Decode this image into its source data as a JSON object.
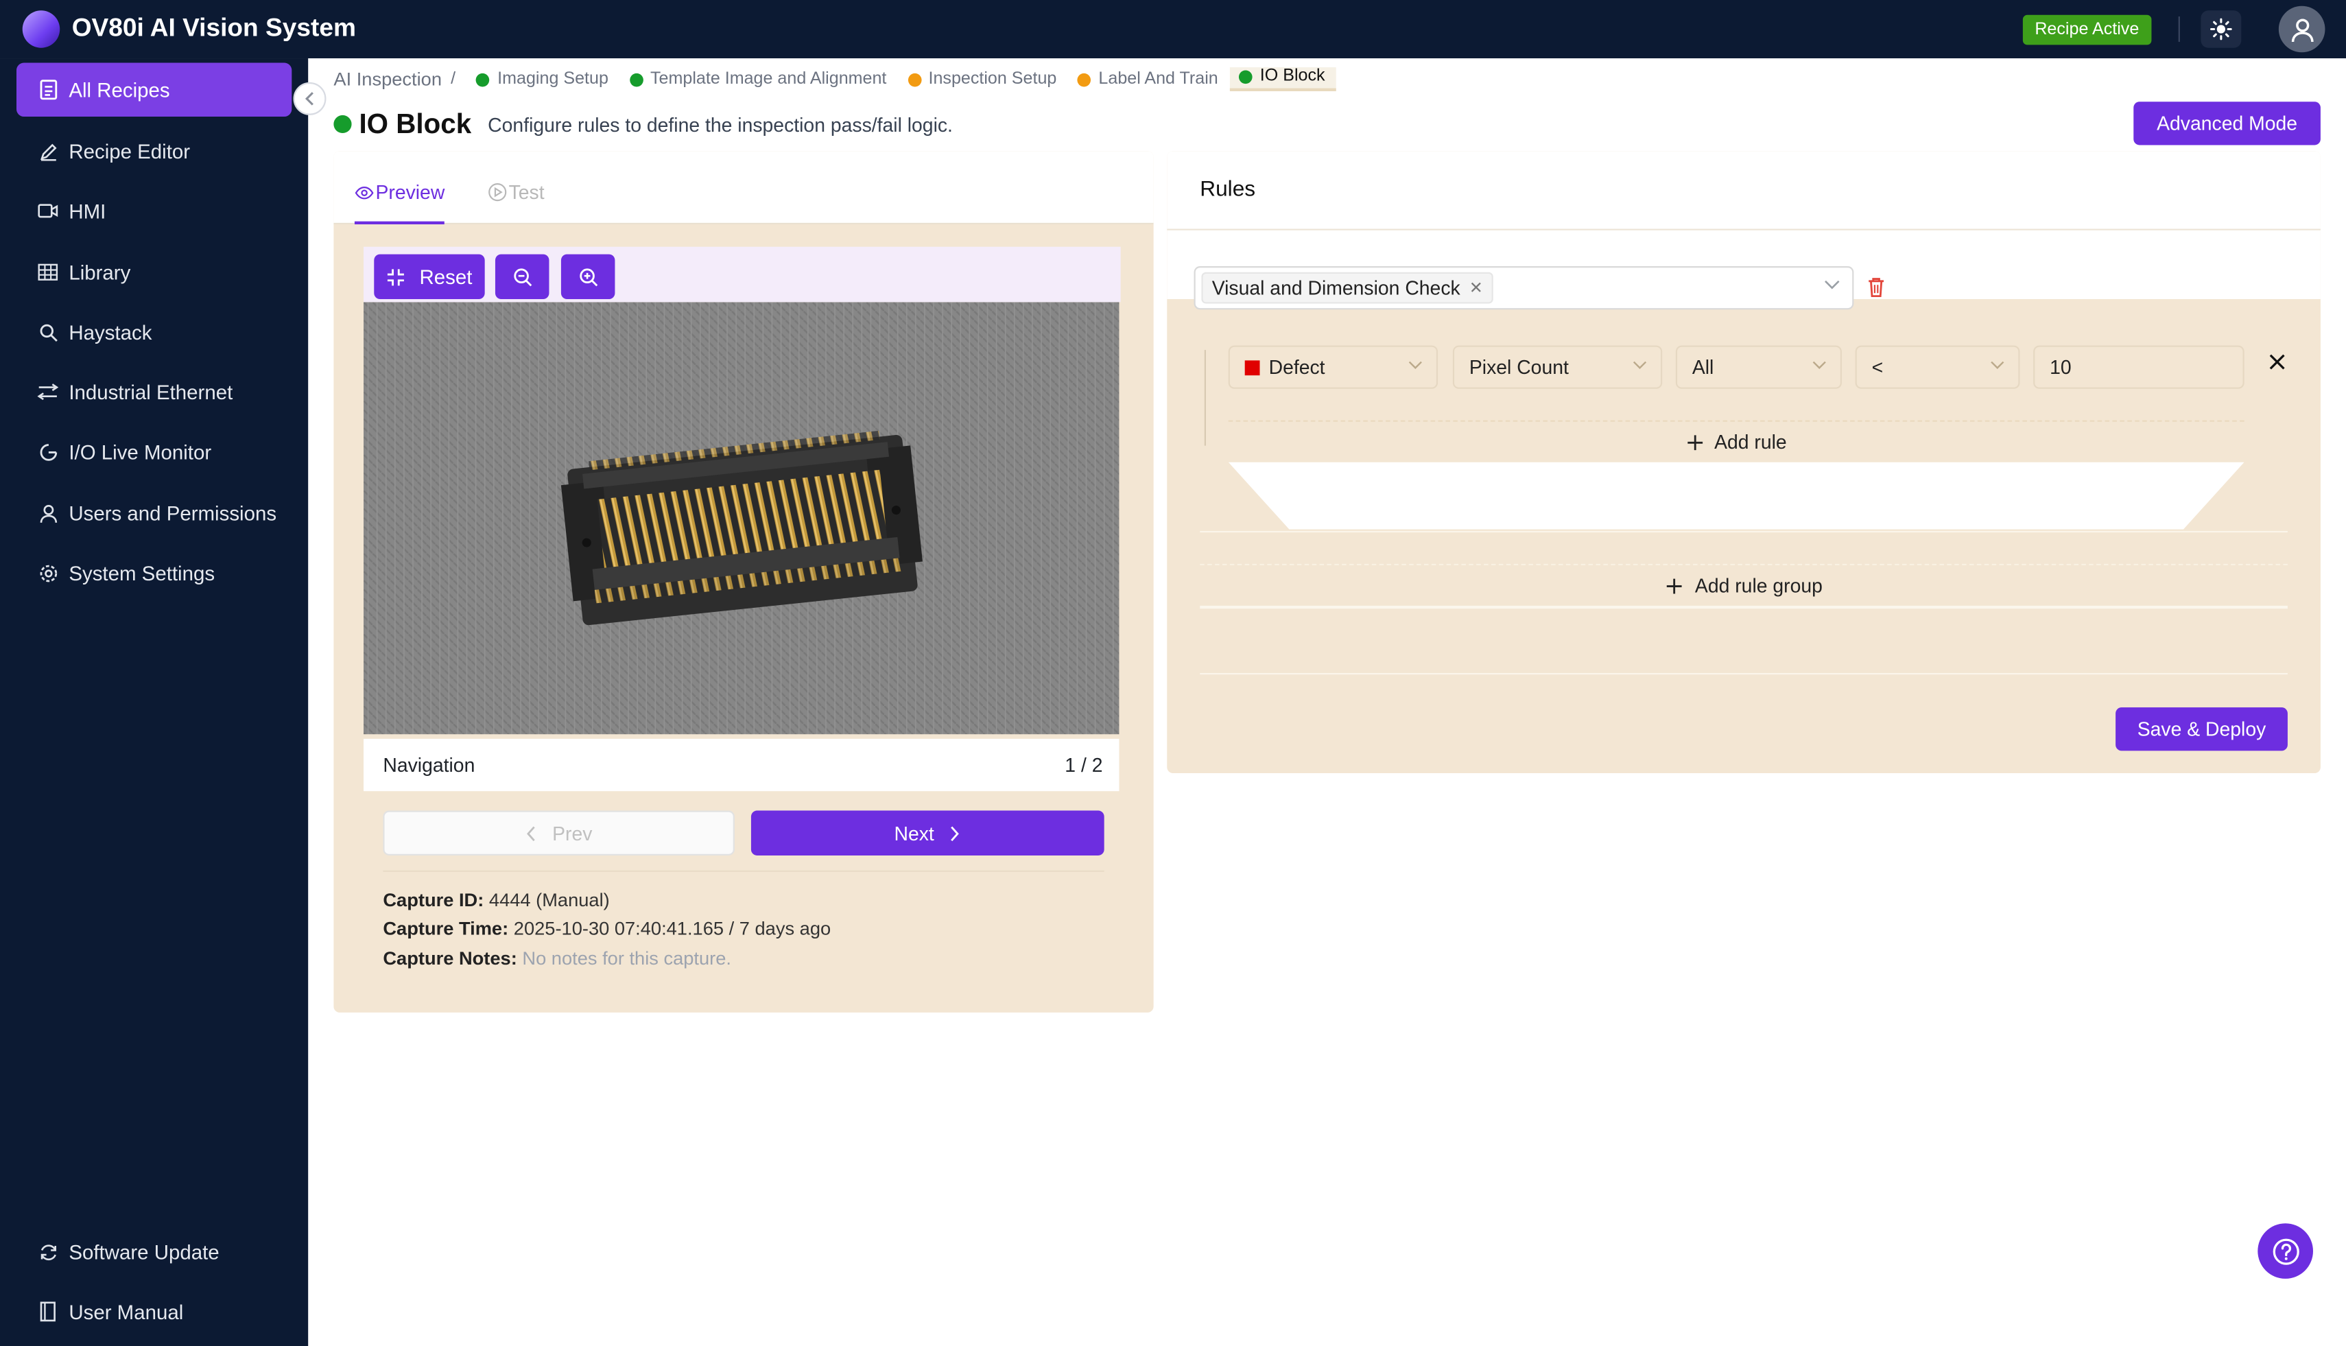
{
  "app": {
    "title": "OV80i AI Vision System",
    "status_badge": "Recipe Active",
    "accent_color": "#6d2ee0",
    "status_color": "#3ea01a"
  },
  "sidebar": {
    "items": [
      {
        "label": "All Recipes",
        "icon": "file-list-icon",
        "active": true
      },
      {
        "label": "Recipe Editor",
        "icon": "pencil-icon"
      },
      {
        "label": "HMI",
        "icon": "video-icon"
      },
      {
        "label": "Library",
        "icon": "grid-icon"
      },
      {
        "label": "Haystack",
        "icon": "search-icon"
      },
      {
        "label": "Industrial Ethernet",
        "icon": "ethernet-icon"
      },
      {
        "label": "I/O Live Monitor",
        "icon": "monitor-icon"
      },
      {
        "label": "Users and Permissions",
        "icon": "user-icon"
      },
      {
        "label": "System Settings",
        "icon": "gear-icon"
      }
    ],
    "bottom_items": [
      {
        "label": "Software Update",
        "icon": "refresh-icon"
      },
      {
        "label": "User Manual",
        "icon": "book-icon"
      }
    ]
  },
  "breadcrumb": {
    "root": "AI Inspection",
    "separator": "/",
    "steps": [
      {
        "label": "Imaging Setup",
        "color": "#169c2c"
      },
      {
        "label": "Template Image and Alignment",
        "color": "#169c2c"
      },
      {
        "label": "Inspection Setup",
        "color": "#f29b12"
      },
      {
        "label": "Label And Train",
        "color": "#f29b12"
      },
      {
        "label": "IO Block",
        "color": "#169c2c",
        "current": true
      }
    ]
  },
  "page": {
    "title": "IO Block",
    "description": "Configure rules to define the inspection pass/fail logic.",
    "advanced_button": "Advanced Mode"
  },
  "preview": {
    "tabs": [
      {
        "label": "Preview",
        "active": true,
        "icon": "eye-icon"
      },
      {
        "label": "Test",
        "active": false,
        "icon": "play-circle-icon"
      }
    ],
    "reset_label": "Reset",
    "navigation_label": "Navigation",
    "page_indicator": "1 / 2",
    "prev_label": "Prev",
    "next_label": "Next",
    "capture_id_label": "Capture ID:",
    "capture_id_value": "4444 (Manual)",
    "capture_time_label": "Capture Time:",
    "capture_time_value": "2025-10-30 07:40:41.165 / 7 days ago",
    "capture_notes_label": "Capture Notes:",
    "capture_notes_value": "No notes for this capture."
  },
  "rules": {
    "title": "Rules",
    "group_tag": "Visual and Dimension Check",
    "rule": {
      "class": "Defect",
      "class_color": "#e00000",
      "metric": "Pixel Count",
      "scope": "All",
      "operator": "<",
      "value": "10"
    },
    "add_rule_label": "Add rule",
    "add_group_label": "Add rule group",
    "deploy_label": "Save & Deploy"
  }
}
